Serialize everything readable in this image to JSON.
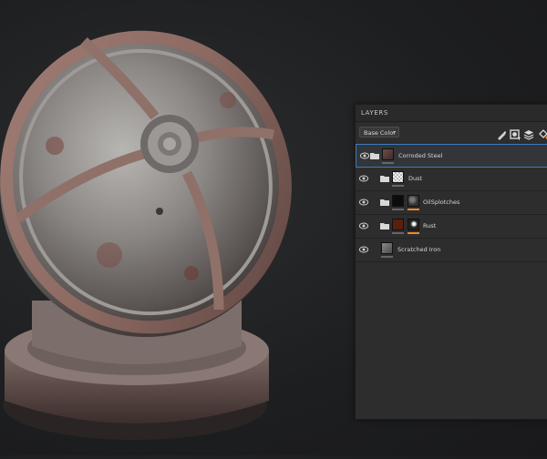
{
  "panel": {
    "title": "LAYERS",
    "channel_dropdown": {
      "selected": "Base Color"
    },
    "toolbar_icons": [
      "paint-brush-icon",
      "add-mask-icon",
      "add-effect-icon",
      "paint-bucket-icon"
    ]
  },
  "layers": [
    {
      "name": "Corroded Steel",
      "type": "folder",
      "visible": true,
      "selected": true
    },
    {
      "name": "Dust",
      "type": "fill",
      "visible": true,
      "selected": false
    },
    {
      "name": "OilSplotches",
      "type": "fill-with-mask",
      "visible": true,
      "selected": false
    },
    {
      "name": "Rust",
      "type": "fill-with-mask",
      "visible": true,
      "selected": false
    },
    {
      "name": "Scratched Iron",
      "type": "fill",
      "visible": true,
      "selected": false
    }
  ],
  "colors": {
    "selection_border": "#3b7bbf",
    "mask_indicator": "#e88a2a",
    "panel_bg": "#2d2d2d"
  }
}
